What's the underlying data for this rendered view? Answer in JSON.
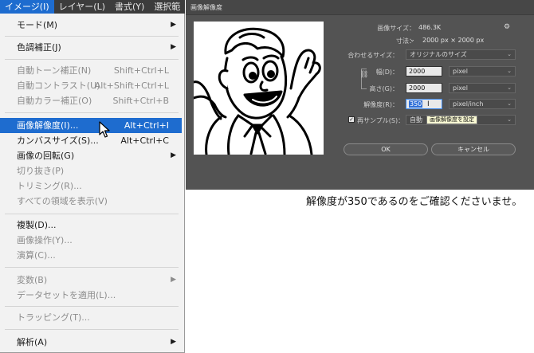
{
  "menubar": {
    "items": [
      "イメージ(I)",
      "レイヤー(L)",
      "書式(Y)",
      "選択範"
    ]
  },
  "menu": {
    "items": [
      {
        "label": "モード(M)",
        "shortcut": "",
        "arrow": "▶"
      },
      {
        "label": "色調補正(J)",
        "shortcut": "",
        "arrow": "▶"
      },
      {
        "label": "自動トーン補正(N)",
        "shortcut": "Shift+Ctrl+L",
        "arrow": ""
      },
      {
        "label": "自動コントラスト(U)",
        "shortcut": "Alt+Shift+Ctrl+L",
        "arrow": ""
      },
      {
        "label": "自動カラー補正(O)",
        "shortcut": "Shift+Ctrl+B",
        "arrow": ""
      },
      {
        "label": "画像解像度(I)...",
        "shortcut": "Alt+Ctrl+I",
        "arrow": ""
      },
      {
        "label": "カンバスサイズ(S)...",
        "shortcut": "Alt+Ctrl+C",
        "arrow": ""
      },
      {
        "label": "画像の回転(G)",
        "shortcut": "",
        "arrow": "▶"
      },
      {
        "label": "切り抜き(P)",
        "shortcut": "",
        "arrow": ""
      },
      {
        "label": "トリミング(R)...",
        "shortcut": "",
        "arrow": ""
      },
      {
        "label": "すべての領域を表示(V)",
        "shortcut": "",
        "arrow": ""
      },
      {
        "label": "複製(D)...",
        "shortcut": "",
        "arrow": ""
      },
      {
        "label": "画像操作(Y)...",
        "shortcut": "",
        "arrow": ""
      },
      {
        "label": "演算(C)...",
        "shortcut": "",
        "arrow": ""
      },
      {
        "label": "変数(B)",
        "shortcut": "",
        "arrow": "▶"
      },
      {
        "label": "データセットを適用(L)...",
        "shortcut": "",
        "arrow": ""
      },
      {
        "label": "トラッピング(T)...",
        "shortcut": "",
        "arrow": ""
      },
      {
        "label": "解析(A)",
        "shortcut": "",
        "arrow": "▶"
      }
    ]
  },
  "dialog": {
    "title": "画像解像度",
    "image_size_label": "画像サイズ：",
    "image_size_value": "486.3K",
    "dimensions_label": "寸法：",
    "dimensions_chevron": "⌄",
    "dimensions_value": "2000 px × 2000 px",
    "fit_label": "合わせるサイズ：",
    "fit_value": "オリジナルのサイズ",
    "width_label": "幅(D)：",
    "width_value": "2000",
    "width_unit": "pixel",
    "height_label": "高さ(G)：",
    "height_value": "2000",
    "height_unit": "pixel",
    "resolution_label": "解像度(R)：",
    "resolution_value": "350",
    "resolution_unit": "pixel/inch",
    "resample_label": "再サンプル(S)：",
    "resample_check": "✓",
    "resample_value": "自動",
    "tooltip": "画像解像度を設定",
    "ok_label": "OK",
    "cancel_label": "キャンセル",
    "gear_icon": "⚙"
  },
  "caption": "解像度が350であるのをご確認くださいませ。"
}
